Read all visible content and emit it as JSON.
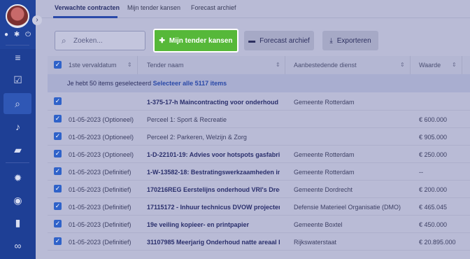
{
  "tabs": [
    {
      "label": "Verwachte contracten"
    },
    {
      "label": "Mijn tender kansen"
    },
    {
      "label": "Forecast archief"
    }
  ],
  "toolbar": {
    "search_placeholder": "Zoeken...",
    "primary_label": "Mijn tender kansen",
    "archive_label": "Forecast archief",
    "export_label": "Exporteren"
  },
  "table": {
    "headers": [
      "1ste vervaldatum",
      "Tender naam",
      "Aanbestedende dienst",
      "Waarde"
    ],
    "banner_text": "Je hebt 50 items geselecteerd ",
    "banner_link": "Selecteer alle 5117 items",
    "rows": [
      {
        "date": "",
        "name": "1-375-17-h Maincontracting voor onderhoud v...",
        "bold": true,
        "org": "Gemeente Rotterdam",
        "value": ""
      },
      {
        "date": "01-05-2023 (Optioneel)",
        "name": "Perceel 1: Sport & Recreatie",
        "bold": false,
        "org": "",
        "value": "€ 600.000"
      },
      {
        "date": "01-05-2023 (Optioneel)",
        "name": "Perceel 2: Parkeren, Welzijn & Zorg",
        "bold": false,
        "org": "",
        "value": "€ 905.000"
      },
      {
        "date": "01-05-2023 (Optioneel)",
        "name": "1-D-22101-19: Advies voor hotspots gasfabrie...",
        "bold": true,
        "org": "Gemeente Rotterdam",
        "value": "€ 250.000"
      },
      {
        "date": "01-05-2023 (Definitief)",
        "name": "1-W-13582-18: Bestratingswerkzaamheden in ...",
        "bold": true,
        "org": "Gemeente Rotterdam",
        "value": "--"
      },
      {
        "date": "01-05-2023 (Definitief)",
        "name": "170216REG Eerstelijns onderhoud VRI's Drecht...",
        "bold": true,
        "org": "Gemeente Dordrecht",
        "value": "€ 200.000"
      },
      {
        "date": "01-05-2023 (Definitief)",
        "name": "17115172 - Inhuur technicus DVOW projecten ...",
        "bold": true,
        "org": "Defensie Materieel Organisatie (DMO)",
        "value": "€ 465.045"
      },
      {
        "date": "01-05-2023 (Definitief)",
        "name": "19e veiling kopieer- en printpapier",
        "bold": true,
        "org": "Gemeente Boxtel",
        "value": "€ 450.000"
      },
      {
        "date": "01-05-2023 (Definitief)",
        "name": "31107985 Meerjarig Onderhoud natte areaal R...",
        "bold": true,
        "org": "Rijkswaterstaat",
        "value": "€ 20.895.000"
      }
    ]
  },
  "colors": {
    "sidebar": "#1e3f95",
    "accent": "#2a49a8",
    "primary_button": "#56b839"
  }
}
